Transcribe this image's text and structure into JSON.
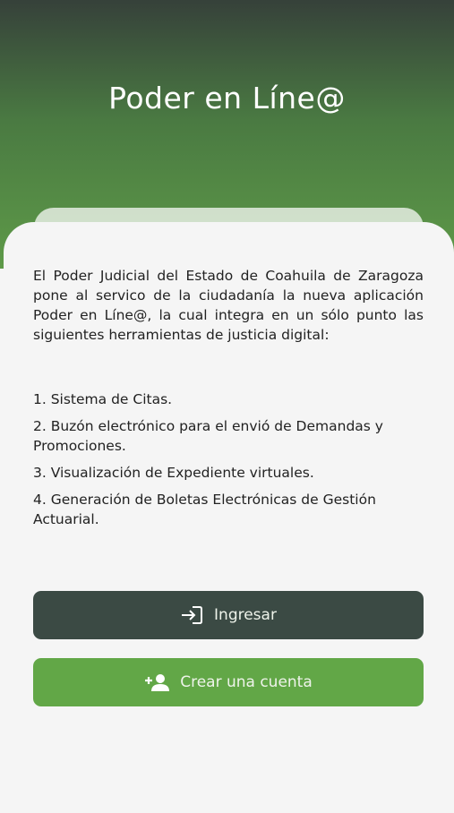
{
  "header": {
    "title": "Poder en Líne@"
  },
  "content": {
    "intro": "El Poder Judicial del Estado de Coahuila de Zaragoza pone al servico de la ciudadanía la nueva aplicación Poder en Líne@, la cual integra en un sólo punto las siguientes herramientas de justicia digital:",
    "items": [
      "1. Sistema de Citas.",
      "2. Buzón electrónico para el envió de Demandas y Promociones.",
      "3. Visualización de Expediente virtuales.",
      "4. Generación de Boletas Electrónicas de Gestión Actuarial."
    ]
  },
  "buttons": {
    "login_label": "Ingresar",
    "login_icon": "login-icon",
    "register_label": "Crear una cuenta",
    "register_icon": "person-add-icon"
  },
  "colors": {
    "header_top": "#36413a",
    "header_bottom": "#5e9a48",
    "login_button": "#3b4a44",
    "register_button": "#62a747",
    "card_background": "#f5f5f5"
  }
}
